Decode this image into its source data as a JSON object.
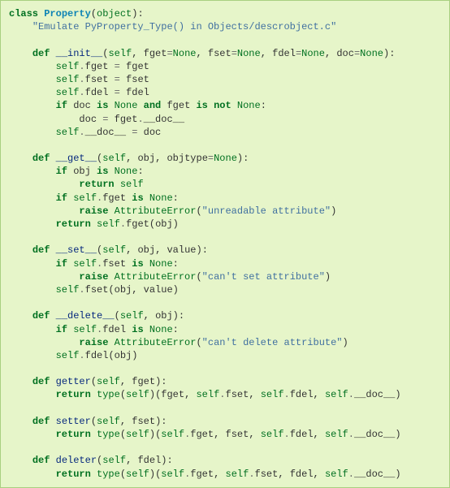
{
  "code": {
    "kw_class": "class",
    "class_name": "Property",
    "kw_object": "object",
    "docstring": "\"Emulate PyProperty_Type() in Objects/descrobject.c\"",
    "kw_def": "def",
    "kw_if": "if",
    "kw_is": "is",
    "kw_not": "not",
    "kw_and": "and",
    "kw_return": "return",
    "kw_raise": "raise",
    "kw_none": "None",
    "kw_self": "self",
    "kw_type": "type",
    "kw_attrerr": "AttributeError",
    "m_init": "__init__",
    "m_get": "__get__",
    "m_set": "__set__",
    "m_delete": "__delete__",
    "m_getter": "getter",
    "m_setter": "setter",
    "m_deleter": "deleter",
    "p_fget": "fget",
    "p_fset": "fset",
    "p_fdel": "fdel",
    "p_doc": "doc",
    "p_obj": "obj",
    "p_objtype": "objtype",
    "p_value": "value",
    "attr_fget": "fget",
    "attr_fset": "fset",
    "attr_fdel": "fdel",
    "attr_doc": "__doc__",
    "str_unreadable": "\"unreadable attribute\"",
    "str_cantset": "\"can't set attribute\"",
    "str_cantdel": "\"can't delete attribute\"",
    "eq": "=",
    "dot": ".",
    "col": ":",
    "com": ",",
    "lp": "(",
    "rp": ")"
  }
}
